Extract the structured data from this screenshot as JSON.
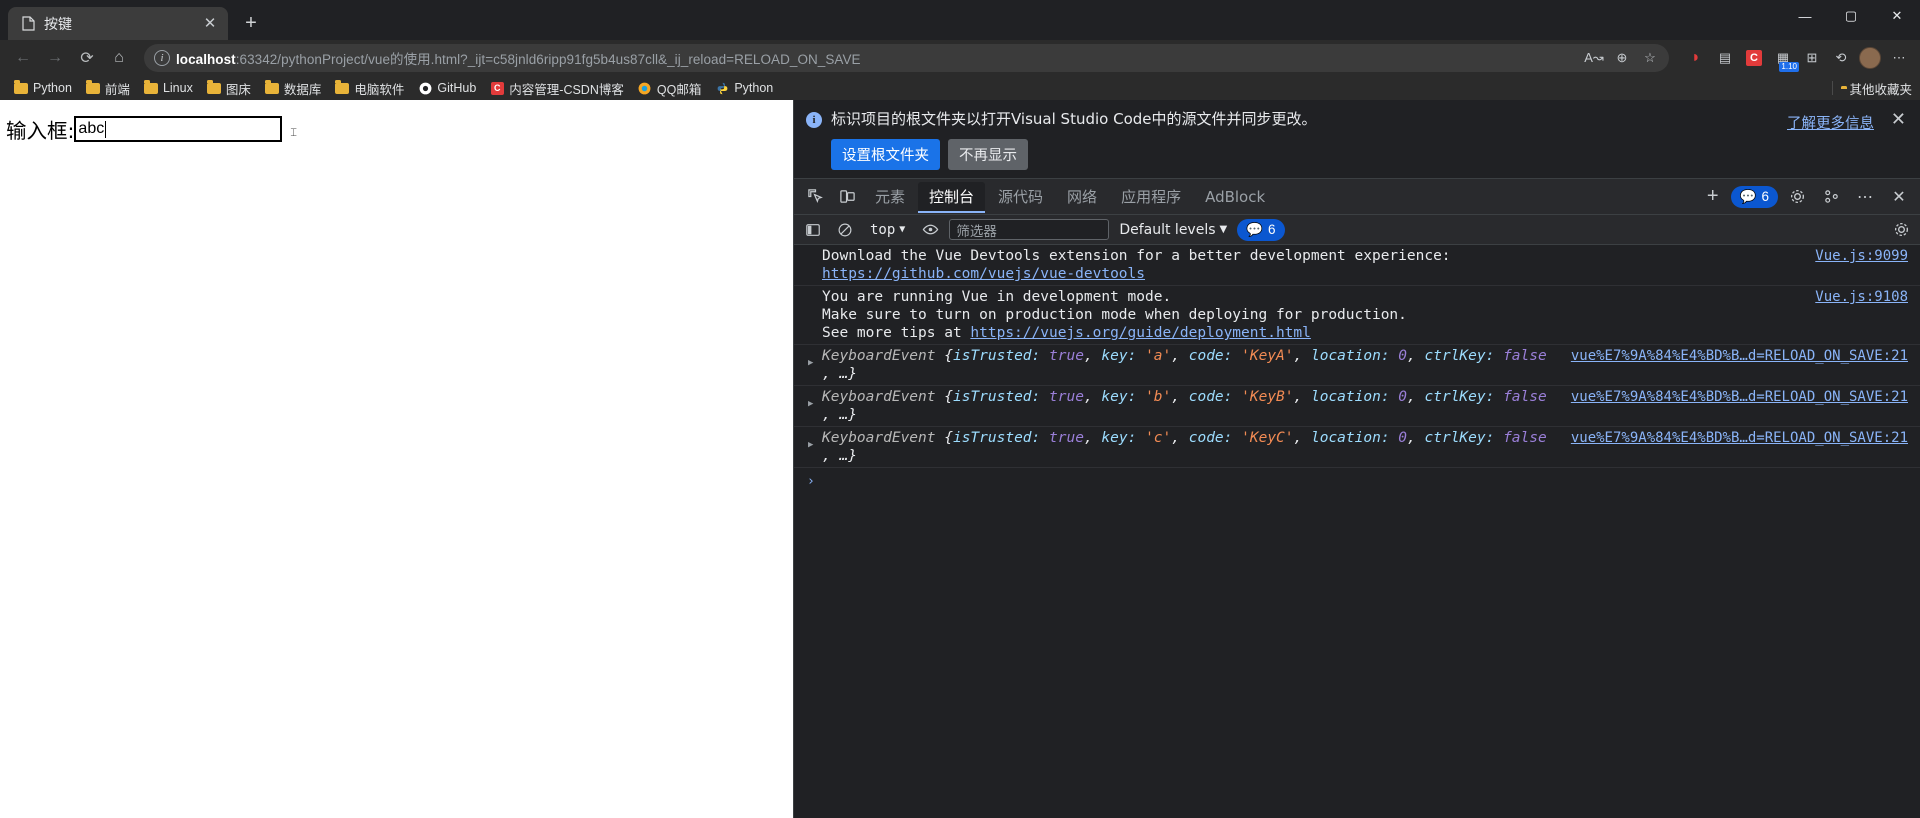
{
  "browser": {
    "tab": {
      "title": "按键",
      "favicon": "document-icon",
      "close": "✕"
    },
    "new_tab": "+",
    "window_controls": {
      "minimize": "—",
      "maximize": "▢",
      "close": "✕"
    },
    "nav": {
      "back": "←",
      "forward": "→",
      "reload": "⟳",
      "home": "⌂"
    },
    "omnibox": {
      "host": "localhost",
      "rest": ":63342/pythonProject/vue的使用.html?_ijt=c58jnld6ripp91fg5b4us87cll&_ij_reload=RELOAD_ON_SAVE",
      "read_aloud": "A↝",
      "zoom_icon": "⊕",
      "favorite_icon": "☆"
    },
    "extensions": [
      {
        "name": "shield-extension-icon",
        "glyph": "◗",
        "color": "#e23b3b"
      },
      {
        "name": "screenshot-extension-icon",
        "glyph": "▤",
        "color": "#c8ccd0"
      },
      {
        "name": "csdn-extension-icon",
        "glyph": "C",
        "color": "#e23b3b"
      },
      {
        "name": "version-badge-icon",
        "glyph": "▦",
        "color": "#c8ccd0",
        "badge": "1.10"
      },
      {
        "name": "puzzle-extensions-icon",
        "glyph": "⊞",
        "color": "#c8ccd0"
      },
      {
        "name": "history-icon",
        "glyph": "⟲",
        "color": "#c8ccd0"
      }
    ],
    "profile_avatar": "avatar",
    "settings_menu": "⋯",
    "bookmarks": [
      {
        "label": "Python",
        "icon": "folder-icon"
      },
      {
        "label": "前端",
        "icon": "folder-icon"
      },
      {
        "label": "Linux",
        "icon": "folder-icon"
      },
      {
        "label": "图床",
        "icon": "folder-icon"
      },
      {
        "label": "数据库",
        "icon": "folder-icon"
      },
      {
        "label": "电脑软件",
        "icon": "folder-icon"
      },
      {
        "label": "GitHub",
        "icon": "github-icon"
      },
      {
        "label": "内容管理-CSDN博客",
        "icon": "csdn-icon"
      },
      {
        "label": "QQ邮箱",
        "icon": "qqmail-icon"
      },
      {
        "label": "Python",
        "icon": "python-icon"
      }
    ],
    "other_bookmarks": "其他收藏夹"
  },
  "page": {
    "label": "输入框:",
    "input_value": "abc",
    "input_placeholder": ""
  },
  "devtools": {
    "banner": {
      "message": "标识项目的根文件夹以打开Visual Studio Code中的源文件并同步更改。",
      "primary_button": "设置根文件夹",
      "secondary_button": "不再显示",
      "learn_more": "了解更多信息",
      "close": "✕"
    },
    "tabs": [
      {
        "label": "元素",
        "active": false
      },
      {
        "label": "控制台",
        "active": true
      },
      {
        "label": "源代码",
        "active": false
      },
      {
        "label": "网络",
        "active": false
      },
      {
        "label": "应用程序",
        "active": false
      },
      {
        "label": "AdBlock",
        "active": false
      }
    ],
    "tab_add": "+",
    "issues_badge": "6",
    "toolbar_icons": {
      "inspect": "inspect-element-icon",
      "device": "device-toolbar-icon",
      "settings": "gear-icon",
      "customize": "more-options-icon",
      "dock": "dock-side-icon",
      "close": "close-icon"
    },
    "console_toolbar": {
      "sidebar_toggle": "console-sidebar-icon",
      "clear": "clear-console-icon",
      "context": "top",
      "context_caret": "▼",
      "eye_icon": "live-expression-icon",
      "filter_placeholder": "筛选器",
      "levels": "Default levels",
      "levels_caret": "▼",
      "issues_count": "6",
      "settings": "gear-icon"
    },
    "messages": [
      {
        "type": "log",
        "text_before": "Download the Vue Devtools extension for a better development experience:",
        "link": "https://github.com/vuejs/vue-devtools",
        "source": "Vue.js:9099"
      },
      {
        "type": "log",
        "line1": "You are running Vue in development mode.",
        "line2": "Make sure to turn on production mode when deploying for production.",
        "line3_before": "See more tips at ",
        "line3_link": "https://vuejs.org/guide/deployment.html",
        "source": "Vue.js:9108"
      },
      {
        "type": "event",
        "name": "KeyboardEvent",
        "isTrusted_key": "isTrusted:",
        "isTrusted_value": "true",
        "key_key": "key:",
        "key_value": "'a'",
        "code_key": "code:",
        "code_value": "'KeyA'",
        "location_key": "location:",
        "location_value": "0",
        "ctrl_key": "ctrlKey:",
        "ctrl_value": "false",
        "ellipsis": ", …}",
        "source": "vue%E7%9A%84%E4%BD%B…d=RELOAD_ON_SAVE:21"
      },
      {
        "type": "event",
        "name": "KeyboardEvent",
        "isTrusted_key": "isTrusted:",
        "isTrusted_value": "true",
        "key_key": "key:",
        "key_value": "'b'",
        "code_key": "code:",
        "code_value": "'KeyB'",
        "location_key": "location:",
        "location_value": "0",
        "ctrl_key": "ctrlKey:",
        "ctrl_value": "false",
        "ellipsis": ", …}",
        "source": "vue%E7%9A%84%E4%BD%B…d=RELOAD_ON_SAVE:21"
      },
      {
        "type": "event",
        "name": "KeyboardEvent",
        "isTrusted_key": "isTrusted:",
        "isTrusted_value": "true",
        "key_key": "key:",
        "key_value": "'c'",
        "code_key": "code:",
        "code_value": "'KeyC'",
        "location_key": "location:",
        "location_value": "0",
        "ctrl_key": "ctrlKey:",
        "ctrl_value": "false",
        "ellipsis": ", …}",
        "source": "vue%E7%9A%84%E4%BD%B…d=RELOAD_ON_SAVE:21"
      }
    ],
    "prompt_caret": "›"
  },
  "colors": {
    "accent_blue": "#1a73e8",
    "link_blue": "#8ab4f8",
    "chrome_bg": "#2b2b2b",
    "devtools_bg": "#202124",
    "string_orange": "#f28b54"
  }
}
